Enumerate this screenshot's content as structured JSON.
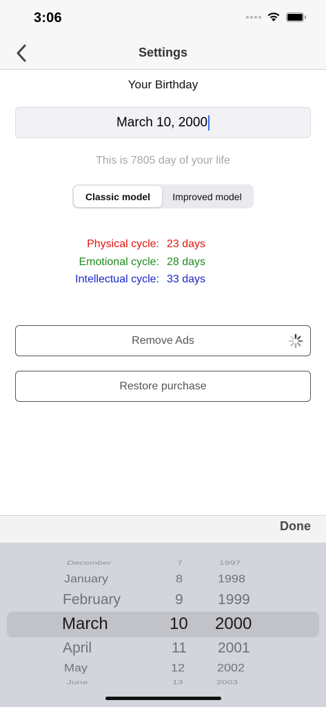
{
  "status_bar": {
    "time": "3:06"
  },
  "nav": {
    "title": "Settings",
    "back_icon": "chevron-left-icon"
  },
  "birthday": {
    "label": "Your Birthday",
    "value": "March 10, 2000",
    "day_of_life_text": "This is 7805 day of your life"
  },
  "model_selector": {
    "options": [
      "Classic model",
      "Improved model"
    ],
    "selected": "Classic model"
  },
  "cycles": [
    {
      "label": "Physical cycle:",
      "value": "23 days",
      "color": "#e3120b"
    },
    {
      "label": "Emotional cycle:",
      "value": "28 days",
      "color": "#1f8a1f"
    },
    {
      "label": "Intellectual cycle:",
      "value": "33 days",
      "color": "#1a24c9"
    }
  ],
  "buttons": {
    "remove_ads": "Remove Ads",
    "restore_purchase": "Restore purchase"
  },
  "toolbar": {
    "done": "Done"
  },
  "date_picker": {
    "months": [
      "December",
      "January",
      "February",
      "March",
      "April",
      "May",
      "June"
    ],
    "days": [
      "7",
      "8",
      "9",
      "10",
      "11",
      "12",
      "13"
    ],
    "years": [
      "1997",
      "1998",
      "1999",
      "2000",
      "2001",
      "2002",
      "2003"
    ],
    "selected": {
      "month": "March",
      "day": "10",
      "year": "2000"
    }
  }
}
